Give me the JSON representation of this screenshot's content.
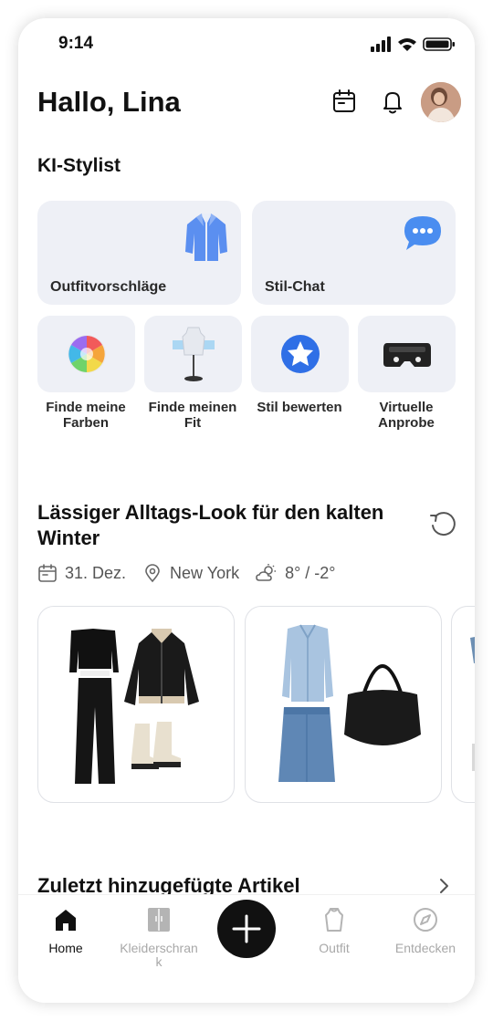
{
  "status_bar": {
    "time": "9:14"
  },
  "header": {
    "greeting": "Hallo, Lina"
  },
  "stylist": {
    "title": "KI-Stylist",
    "big_cards": [
      {
        "label": "Outfitvorschläge",
        "icon": "jacket-icon"
      },
      {
        "label": "Stil-Chat",
        "icon": "chat-bubble-icon"
      }
    ],
    "tiles": [
      {
        "label": "Finde meine Farben",
        "icon": "color-wheel-icon"
      },
      {
        "label": "Finde meinen Fit",
        "icon": "mannequin-icon"
      },
      {
        "label": "Stil bewerten",
        "icon": "star-badge-icon"
      },
      {
        "label": "Virtuelle Anprobe",
        "icon": "vr-headset-icon"
      }
    ]
  },
  "look": {
    "title": "Lässiger Alltags-Look für den kalten Winter",
    "date": "31. Dez.",
    "location": "New York",
    "weather": "8° / -2°"
  },
  "recent": {
    "title": "Zuletzt hinzugefügte Artikel"
  },
  "tabbar": {
    "items": [
      {
        "label": "Home",
        "icon": "home-icon",
        "active": true
      },
      {
        "label": "Kleiderschrank",
        "icon": "wardrobe-icon",
        "active": false
      },
      {
        "label": "Outfit",
        "icon": "shirt-icon",
        "active": false
      },
      {
        "label": "Entdecken",
        "icon": "compass-icon",
        "active": false
      }
    ]
  },
  "colors": {
    "card_bg": "#eef0f6",
    "accent_blue": "#3f7ce8",
    "text": "#111111",
    "inactive": "#a8a8a8"
  }
}
